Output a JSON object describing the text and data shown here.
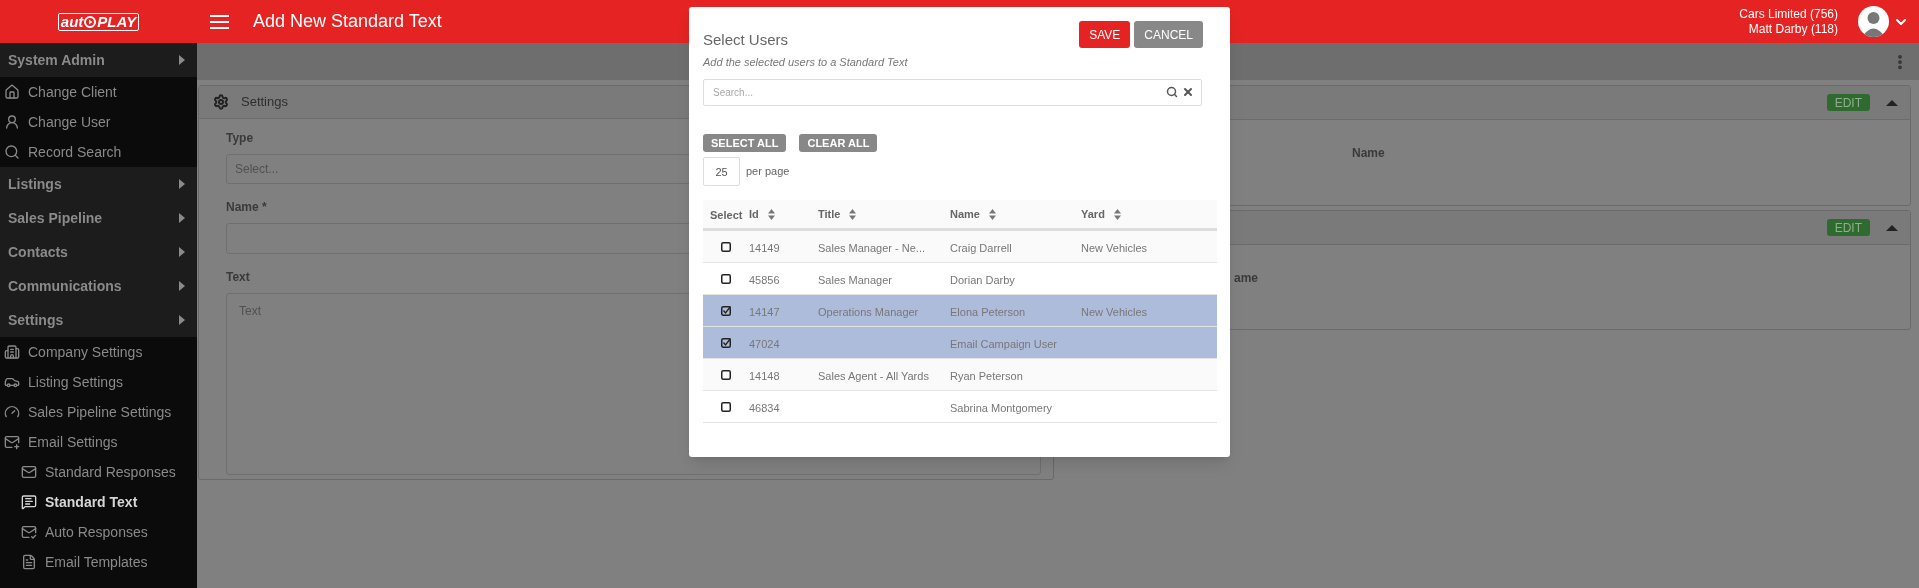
{
  "header": {
    "logo": {
      "left": "aut",
      "right": "PLAY"
    },
    "title": "Add New Standard Text",
    "account": [
      "Cars Limited (756)",
      "Matt Darby (118)"
    ]
  },
  "sidebar": {
    "items": [
      {
        "kind": "section",
        "label": "System Admin",
        "selected": false
      },
      {
        "kind": "item",
        "label": "Change Client",
        "selected": false
      },
      {
        "kind": "item",
        "label": "Change User",
        "selected": false
      },
      {
        "kind": "item",
        "label": "Record Search",
        "selected": false
      },
      {
        "kind": "section",
        "label": "Listings",
        "selected": false
      },
      {
        "kind": "section",
        "label": "Sales Pipeline",
        "selected": false
      },
      {
        "kind": "section",
        "label": "Contacts",
        "selected": false
      },
      {
        "kind": "section",
        "label": "Communications",
        "selected": false
      },
      {
        "kind": "section",
        "label": "Settings",
        "selected": false
      },
      {
        "kind": "item",
        "label": "Company Settings",
        "selected": false
      },
      {
        "kind": "item",
        "label": "Listing Settings",
        "selected": false
      },
      {
        "kind": "item",
        "label": "Sales Pipeline Settings",
        "selected": false
      },
      {
        "kind": "item",
        "label": "Email Settings",
        "selected": false
      },
      {
        "kind": "subitem",
        "label": "Standard Responses",
        "selected": false
      },
      {
        "kind": "subitem",
        "label": "Standard Text",
        "selected": true
      },
      {
        "kind": "subitem",
        "label": "Auto Responses",
        "selected": false
      },
      {
        "kind": "subitem",
        "label": "Email Templates",
        "selected": false
      }
    ]
  },
  "settings_card": {
    "title": "Settings",
    "fields": [
      {
        "kind": "select",
        "label": "Type",
        "placeholder": "Select..."
      },
      {
        "kind": "input",
        "label": "Name *"
      },
      {
        "kind": "textarea",
        "label": "Text",
        "placeholder": "Text"
      }
    ]
  },
  "right_cards": [
    {
      "edit": "EDIT",
      "expanded": true,
      "label": "Name"
    },
    {
      "edit": "EDIT",
      "expanded": true,
      "label": "ame"
    }
  ],
  "modal": {
    "title": "Select Users",
    "subtitle": "Add the selected users to a Standard Text",
    "search": {
      "placeholder": "Search..."
    },
    "save": "SAVE",
    "cancel": "CANCEL",
    "select_all": "SELECT ALL",
    "clear_all": "CLEAR ALL",
    "per_page": {
      "value": "25",
      "label": "per page"
    },
    "select_header": "Select",
    "columns": [
      {
        "label": "Id"
      },
      {
        "label": "Title"
      },
      {
        "label": "Name"
      },
      {
        "label": "Yard"
      }
    ],
    "rows": [
      {
        "checked": false,
        "selected": false,
        "cells": [
          "14149",
          "Sales Manager - Ne...",
          "Craig Darrell",
          "New Vehicles"
        ]
      },
      {
        "checked": false,
        "selected": false,
        "cells": [
          "45856",
          "Sales Manager",
          "Dorian Darby",
          ""
        ]
      },
      {
        "checked": true,
        "selected": true,
        "cells": [
          "14147",
          "Operations Manager",
          "Elona Peterson",
          "New Vehicles"
        ]
      },
      {
        "checked": true,
        "selected": true,
        "cells": [
          "47024",
          "",
          "Email Campaign User",
          ""
        ]
      },
      {
        "checked": false,
        "selected": false,
        "cells": [
          "14148",
          "Sales Agent - All Yards",
          "Ryan Peterson",
          ""
        ]
      },
      {
        "checked": false,
        "selected": false,
        "cells": [
          "46834",
          "",
          "Sabrina Montgomery",
          ""
        ]
      }
    ]
  }
}
